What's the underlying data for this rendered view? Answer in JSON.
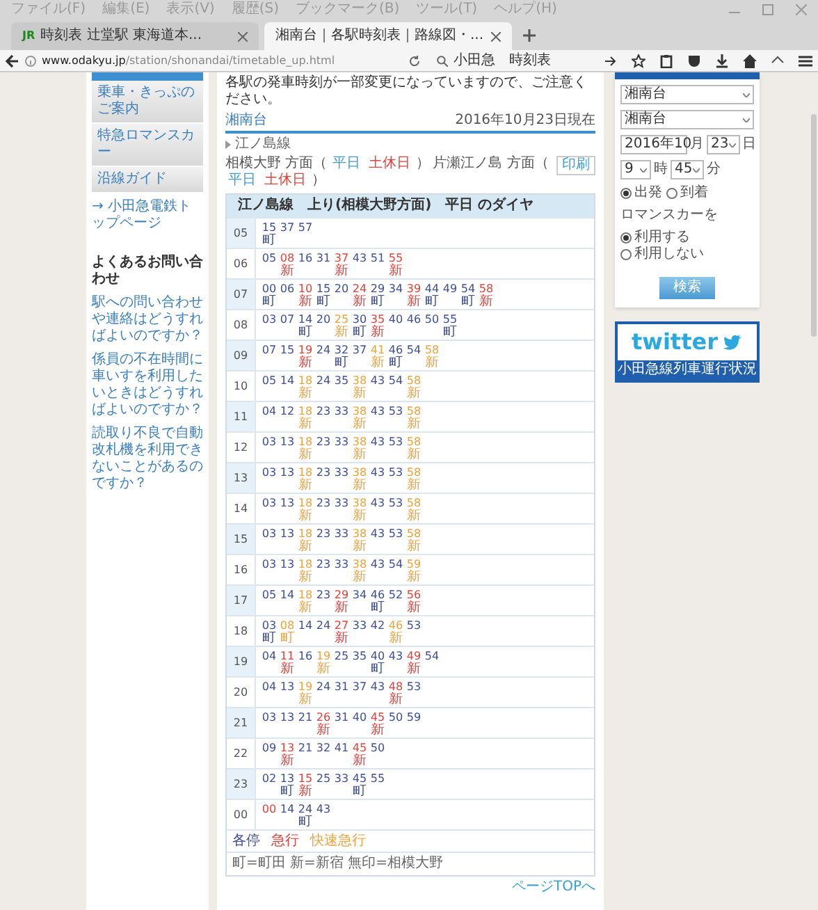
{
  "browser": {
    "menu": [
      "ファイル(F)",
      "編集(E)",
      "表示(V)",
      "履歴(S)",
      "ブックマーク(B)",
      "ツール(T)",
      "ヘルプ(H)"
    ],
    "tabs": [
      {
        "title": "時刻表 辻堂駅 東海道本...",
        "selected": false,
        "logo": "JR"
      },
      {
        "title": "湘南台｜各駅時刻表｜路線図・...",
        "selected": true
      }
    ],
    "url_host": "www.odakyu.jp",
    "url_path": "/station/shonandai/timetable_up.html",
    "search": "小田急　時刻表"
  },
  "left_sidebar": {
    "menu": [
      "乗車・きっぷのご案内",
      "特急ロマンスカー",
      "沿線ガイド"
    ],
    "top_link": "→ 小田急電鉄トップページ",
    "faq_title": "よくあるお問い合わせ",
    "faq": [
      "駅への問い合わせや連絡はどうすればよいのですか？",
      "係員の不在時間に車いすを利用したいときはどうすればよいのですか？",
      "読取り不良で自動改札機を利用できないことがあるのですか？"
    ]
  },
  "main": {
    "notice": "各駅の発車時刻が一部変更になっていますので、ご注意ください。",
    "station": "湘南台",
    "as_of": "2016年10月23日現在",
    "line": "江ノ島線",
    "directions": [
      {
        "label": "相模大野 方面（",
        "links": [
          {
            "label": "平日",
            "kind": "weekday"
          },
          {
            "label": "土休日",
            "kind": "holiday"
          }
        ],
        "end": "）"
      },
      {
        "label": "片瀬江ノ島 方面（",
        "links": [
          {
            "label": "平日",
            "kind": "weekday"
          },
          {
            "label": "土休日",
            "kind": "holiday"
          }
        ],
        "end": "）"
      }
    ],
    "print_button": "印刷",
    "table_title": "江ノ島線　上り(相模大野方面)　平日 のダイヤ",
    "rows": [
      {
        "hour": "05",
        "trains": [
          {
            "min": "15",
            "kind": "local",
            "note": "町"
          },
          {
            "min": "37",
            "kind": "local"
          },
          {
            "min": "57",
            "kind": "local"
          }
        ]
      },
      {
        "hour": "06",
        "trains": [
          {
            "min": "05",
            "kind": "local"
          },
          {
            "min": "08",
            "kind": "express",
            "note": "新"
          },
          {
            "min": "16",
            "kind": "local"
          },
          {
            "min": "31",
            "kind": "local"
          },
          {
            "min": "37",
            "kind": "express",
            "note": "新"
          },
          {
            "min": "43",
            "kind": "local"
          },
          {
            "min": "51",
            "kind": "local"
          },
          {
            "min": "55",
            "kind": "express",
            "note": "新"
          }
        ]
      },
      {
        "hour": "07",
        "trains": [
          {
            "min": "00",
            "kind": "local",
            "note": "町"
          },
          {
            "min": "06",
            "kind": "local"
          },
          {
            "min": "10",
            "kind": "express",
            "note": "新"
          },
          {
            "min": "15",
            "kind": "local",
            "note": "町"
          },
          {
            "min": "20",
            "kind": "local"
          },
          {
            "min": "24",
            "kind": "express",
            "note": "新"
          },
          {
            "min": "29",
            "kind": "local",
            "note": "町"
          },
          {
            "min": "34",
            "kind": "local"
          },
          {
            "min": "39",
            "kind": "express",
            "note": "新"
          },
          {
            "min": "44",
            "kind": "local",
            "note": "町"
          },
          {
            "min": "49",
            "kind": "local"
          },
          {
            "min": "54",
            "kind": "local",
            "note": "町"
          },
          {
            "min": "58",
            "kind": "express",
            "note": "新"
          }
        ]
      },
      {
        "hour": "08",
        "trains": [
          {
            "min": "03",
            "kind": "local"
          },
          {
            "min": "07",
            "kind": "local"
          },
          {
            "min": "14",
            "kind": "local",
            "note": "町"
          },
          {
            "min": "20",
            "kind": "local"
          },
          {
            "min": "25",
            "kind": "rapid",
            "note": "新"
          },
          {
            "min": "30",
            "kind": "local",
            "note": "町"
          },
          {
            "min": "35",
            "kind": "express",
            "note": "新"
          },
          {
            "min": "40",
            "kind": "local"
          },
          {
            "min": "46",
            "kind": "local"
          },
          {
            "min": "50",
            "kind": "local"
          },
          {
            "min": "55",
            "kind": "local",
            "note": "町"
          }
        ]
      },
      {
        "hour": "09",
        "trains": [
          {
            "min": "07",
            "kind": "local"
          },
          {
            "min": "15",
            "kind": "local"
          },
          {
            "min": "19",
            "kind": "express",
            "note": "新"
          },
          {
            "min": "24",
            "kind": "local"
          },
          {
            "min": "32",
            "kind": "local",
            "note": "町"
          },
          {
            "min": "37",
            "kind": "local"
          },
          {
            "min": "41",
            "kind": "rapid",
            "note": "新"
          },
          {
            "min": "46",
            "kind": "local",
            "note": "町"
          },
          {
            "min": "54",
            "kind": "local"
          },
          {
            "min": "58",
            "kind": "rapid",
            "note": "新"
          }
        ]
      },
      {
        "hour": "10",
        "trains": [
          {
            "min": "05",
            "kind": "local"
          },
          {
            "min": "14",
            "kind": "local"
          },
          {
            "min": "18",
            "kind": "rapid",
            "note": "新"
          },
          {
            "min": "24",
            "kind": "local"
          },
          {
            "min": "35",
            "kind": "local"
          },
          {
            "min": "38",
            "kind": "rapid",
            "note": "新"
          },
          {
            "min": "43",
            "kind": "local"
          },
          {
            "min": "54",
            "kind": "local"
          },
          {
            "min": "58",
            "kind": "rapid",
            "note": "新"
          }
        ]
      },
      {
        "hour": "11",
        "trains": [
          {
            "min": "04",
            "kind": "local"
          },
          {
            "min": "12",
            "kind": "local"
          },
          {
            "min": "18",
            "kind": "rapid",
            "note": "新"
          },
          {
            "min": "23",
            "kind": "local"
          },
          {
            "min": "33",
            "kind": "local"
          },
          {
            "min": "38",
            "kind": "rapid",
            "note": "新"
          },
          {
            "min": "43",
            "kind": "local"
          },
          {
            "min": "53",
            "kind": "local"
          },
          {
            "min": "58",
            "kind": "rapid",
            "note": "新"
          }
        ]
      },
      {
        "hour": "12",
        "trains": [
          {
            "min": "03",
            "kind": "local"
          },
          {
            "min": "13",
            "kind": "local"
          },
          {
            "min": "18",
            "kind": "rapid",
            "note": "新"
          },
          {
            "min": "23",
            "kind": "local"
          },
          {
            "min": "33",
            "kind": "local"
          },
          {
            "min": "38",
            "kind": "rapid",
            "note": "新"
          },
          {
            "min": "43",
            "kind": "local"
          },
          {
            "min": "53",
            "kind": "local"
          },
          {
            "min": "58",
            "kind": "rapid",
            "note": "新"
          }
        ]
      },
      {
        "hour": "13",
        "trains": [
          {
            "min": "03",
            "kind": "local"
          },
          {
            "min": "13",
            "kind": "local"
          },
          {
            "min": "18",
            "kind": "rapid",
            "note": "新"
          },
          {
            "min": "23",
            "kind": "local"
          },
          {
            "min": "33",
            "kind": "local"
          },
          {
            "min": "38",
            "kind": "rapid",
            "note": "新"
          },
          {
            "min": "43",
            "kind": "local"
          },
          {
            "min": "53",
            "kind": "local"
          },
          {
            "min": "58",
            "kind": "rapid",
            "note": "新"
          }
        ]
      },
      {
        "hour": "14",
        "trains": [
          {
            "min": "03",
            "kind": "local"
          },
          {
            "min": "13",
            "kind": "local"
          },
          {
            "min": "18",
            "kind": "rapid",
            "note": "新"
          },
          {
            "min": "23",
            "kind": "local"
          },
          {
            "min": "33",
            "kind": "local"
          },
          {
            "min": "38",
            "kind": "rapid",
            "note": "新"
          },
          {
            "min": "43",
            "kind": "local"
          },
          {
            "min": "53",
            "kind": "local"
          },
          {
            "min": "58",
            "kind": "rapid",
            "note": "新"
          }
        ]
      },
      {
        "hour": "15",
        "trains": [
          {
            "min": "03",
            "kind": "local"
          },
          {
            "min": "13",
            "kind": "local"
          },
          {
            "min": "18",
            "kind": "rapid",
            "note": "新"
          },
          {
            "min": "23",
            "kind": "local"
          },
          {
            "min": "33",
            "kind": "local"
          },
          {
            "min": "38",
            "kind": "rapid",
            "note": "新"
          },
          {
            "min": "43",
            "kind": "local"
          },
          {
            "min": "53",
            "kind": "local"
          },
          {
            "min": "58",
            "kind": "rapid",
            "note": "新"
          }
        ]
      },
      {
        "hour": "16",
        "trains": [
          {
            "min": "03",
            "kind": "local"
          },
          {
            "min": "13",
            "kind": "local"
          },
          {
            "min": "18",
            "kind": "rapid",
            "note": "新"
          },
          {
            "min": "23",
            "kind": "local"
          },
          {
            "min": "33",
            "kind": "local"
          },
          {
            "min": "38",
            "kind": "rapid",
            "note": "新"
          },
          {
            "min": "43",
            "kind": "local"
          },
          {
            "min": "54",
            "kind": "local"
          },
          {
            "min": "59",
            "kind": "rapid",
            "note": "新"
          }
        ]
      },
      {
        "hour": "17",
        "trains": [
          {
            "min": "05",
            "kind": "local"
          },
          {
            "min": "14",
            "kind": "local"
          },
          {
            "min": "18",
            "kind": "rapid",
            "note": "新"
          },
          {
            "min": "23",
            "kind": "local"
          },
          {
            "min": "29",
            "kind": "express",
            "note": "新"
          },
          {
            "min": "34",
            "kind": "local"
          },
          {
            "min": "46",
            "kind": "local",
            "note": "町"
          },
          {
            "min": "52",
            "kind": "local"
          },
          {
            "min": "56",
            "kind": "express",
            "note": "新"
          }
        ]
      },
      {
        "hour": "18",
        "trains": [
          {
            "min": "03",
            "kind": "local",
            "note": "町"
          },
          {
            "min": "08",
            "kind": "rapid",
            "note": "町"
          },
          {
            "min": "14",
            "kind": "local"
          },
          {
            "min": "24",
            "kind": "local"
          },
          {
            "min": "27",
            "kind": "express",
            "note": "新"
          },
          {
            "min": "33",
            "kind": "local"
          },
          {
            "min": "42",
            "kind": "local"
          },
          {
            "min": "46",
            "kind": "rapid",
            "note": "新"
          },
          {
            "min": "53",
            "kind": "local"
          }
        ]
      },
      {
        "hour": "19",
        "trains": [
          {
            "min": "04",
            "kind": "local"
          },
          {
            "min": "11",
            "kind": "express",
            "note": "新"
          },
          {
            "min": "16",
            "kind": "local"
          },
          {
            "min": "19",
            "kind": "rapid",
            "note": "新"
          },
          {
            "min": "25",
            "kind": "local"
          },
          {
            "min": "35",
            "kind": "local"
          },
          {
            "min": "40",
            "kind": "local",
            "note": "町"
          },
          {
            "min": "43",
            "kind": "local"
          },
          {
            "min": "49",
            "kind": "express",
            "note": "新"
          },
          {
            "min": "54",
            "kind": "local"
          }
        ]
      },
      {
        "hour": "20",
        "trains": [
          {
            "min": "04",
            "kind": "local"
          },
          {
            "min": "13",
            "kind": "local"
          },
          {
            "min": "19",
            "kind": "rapid",
            "note": "新"
          },
          {
            "min": "24",
            "kind": "local"
          },
          {
            "min": "31",
            "kind": "local"
          },
          {
            "min": "37",
            "kind": "local"
          },
          {
            "min": "43",
            "kind": "local"
          },
          {
            "min": "48",
            "kind": "express",
            "note": "新"
          },
          {
            "min": "53",
            "kind": "local"
          }
        ]
      },
      {
        "hour": "21",
        "trains": [
          {
            "min": "03",
            "kind": "local"
          },
          {
            "min": "13",
            "kind": "local"
          },
          {
            "min": "21",
            "kind": "local"
          },
          {
            "min": "26",
            "kind": "express",
            "note": "新"
          },
          {
            "min": "31",
            "kind": "local"
          },
          {
            "min": "40",
            "kind": "local"
          },
          {
            "min": "45",
            "kind": "express",
            "note": "新"
          },
          {
            "min": "50",
            "kind": "local"
          },
          {
            "min": "59",
            "kind": "local"
          }
        ]
      },
      {
        "hour": "22",
        "trains": [
          {
            "min": "09",
            "kind": "local"
          },
          {
            "min": "13",
            "kind": "express",
            "note": "新"
          },
          {
            "min": "21",
            "kind": "local"
          },
          {
            "min": "32",
            "kind": "local"
          },
          {
            "min": "41",
            "kind": "local"
          },
          {
            "min": "45",
            "kind": "express",
            "note": "新"
          },
          {
            "min": "50",
            "kind": "local"
          }
        ]
      },
      {
        "hour": "23",
        "trains": [
          {
            "min": "02",
            "kind": "local"
          },
          {
            "min": "13",
            "kind": "local",
            "note": "町"
          },
          {
            "min": "15",
            "kind": "express",
            "note": "新"
          },
          {
            "min": "25",
            "kind": "local"
          },
          {
            "min": "33",
            "kind": "local"
          },
          {
            "min": "45",
            "kind": "local",
            "note": "町"
          },
          {
            "min": "55",
            "kind": "local"
          }
        ]
      },
      {
        "hour": "00",
        "trains": [
          {
            "min": "00",
            "kind": "express"
          },
          {
            "min": "14",
            "kind": "local"
          },
          {
            "min": "24",
            "kind": "local",
            "note": "町"
          },
          {
            "min": "43",
            "kind": "local"
          }
        ]
      }
    ],
    "legend": [
      {
        "label": "各停",
        "kind": "local"
      },
      {
        "label": "急行",
        "kind": "express"
      },
      {
        "label": "快速急行",
        "kind": "rapid"
      }
    ],
    "note": "町=町田 新=新宿 無印=相模大野",
    "top_link": "ページTOPへ"
  },
  "search_panel": {
    "from": "湘南台",
    "to": "湘南台",
    "month": "2016年10",
    "month_unit": "月",
    "day": "23",
    "day_unit": "日",
    "hour": "9",
    "hour_unit": "時",
    "minute": "45",
    "minute_unit": "分",
    "time_mode": [
      {
        "label": "出発",
        "selected": true
      },
      {
        "label": "到着",
        "selected": false
      }
    ],
    "romancecar_label": "ロマンスカーを",
    "romancecar": [
      {
        "label": "利用する",
        "selected": true
      },
      {
        "label": "利用しない",
        "selected": false
      }
    ],
    "search_button": "検索"
  },
  "twitter": {
    "logo": "twitter",
    "caption": "小田急線列車運行状況"
  }
}
